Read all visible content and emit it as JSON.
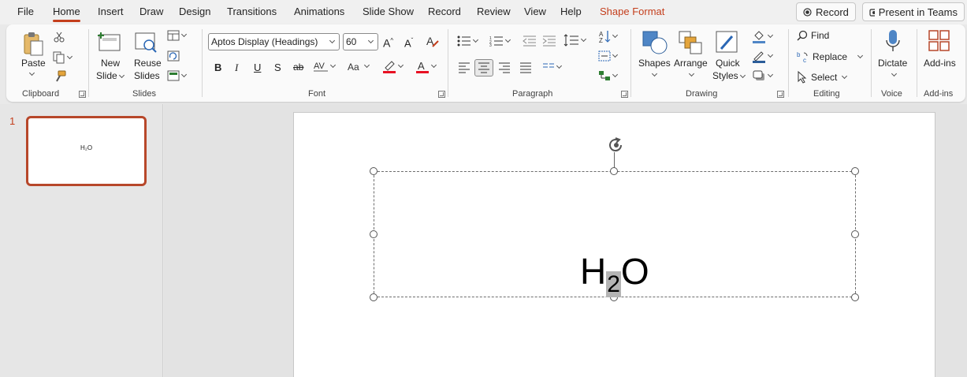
{
  "tabs": {
    "file": "File",
    "home": "Home",
    "insert": "Insert",
    "draw": "Draw",
    "design": "Design",
    "transitions": "Transitions",
    "animations": "Animations",
    "slideshow": "Slide Show",
    "record": "Record",
    "review": "Review",
    "view": "View",
    "help": "Help",
    "shape_format": "Shape Format"
  },
  "header_buttons": {
    "record": "Record",
    "present": "Present in Teams"
  },
  "ribbon": {
    "clipboard": {
      "paste": "Paste",
      "group": "Clipboard"
    },
    "slides": {
      "new_slide_1": "New",
      "new_slide_2": "Slide",
      "reuse_1": "Reuse",
      "reuse_2": "Slides",
      "group": "Slides"
    },
    "font": {
      "font_name": "Aptos Display (Headings)",
      "font_size": "60",
      "bold": "B",
      "italic": "I",
      "underline": "U",
      "shadow": "S",
      "strike": "ab",
      "group": "Font"
    },
    "paragraph": {
      "group": "Paragraph"
    },
    "drawing": {
      "shapes": "Shapes",
      "arrange": "Arrange",
      "quick_1": "Quick",
      "quick_2": "Styles",
      "group": "Drawing"
    },
    "editing": {
      "find": "Find",
      "replace": "Replace",
      "select": "Select",
      "group": "Editing"
    },
    "voice": {
      "dictate": "Dictate",
      "group": "Voice"
    },
    "addins": {
      "addins": "Add-ins",
      "group": "Add-ins"
    }
  },
  "slides_panel": {
    "slide_number": "1",
    "thumb_text": "H₂O"
  },
  "slide": {
    "text_main": "H",
    "text_sub": "2",
    "text_end": "O"
  },
  "colors": {
    "accent": "#c43e1c",
    "selection_highlight": "#b4b4b4"
  }
}
